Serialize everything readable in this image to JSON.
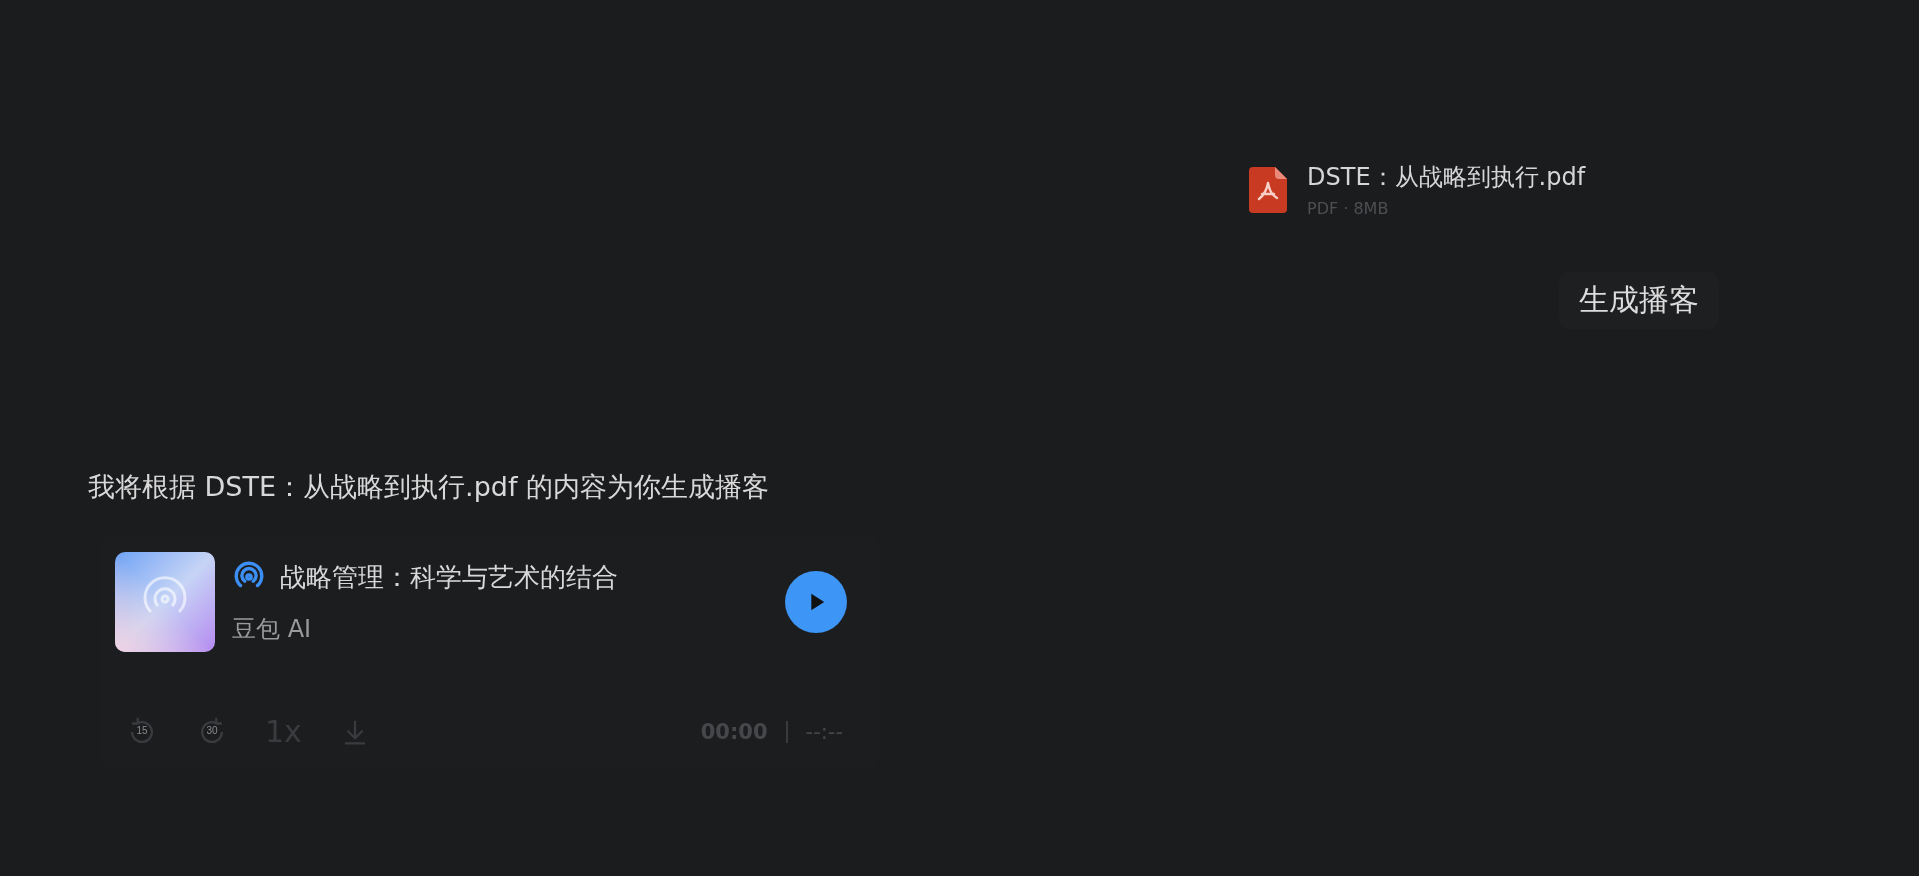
{
  "attachment": {
    "name": "DSTE：从战略到执行.pdf",
    "meta": "PDF · 8MB"
  },
  "user_message": "生成播客",
  "reply": "我将根据 DSTE：从战略到执行.pdf 的内容为你生成播客",
  "podcast": {
    "title": "战略管理：科学与艺术的结合",
    "author": "豆包 AI",
    "controls": {
      "rewind": "15",
      "forward": "30",
      "speed": "1x",
      "current_time": "00:00",
      "duration": "--:--"
    }
  }
}
